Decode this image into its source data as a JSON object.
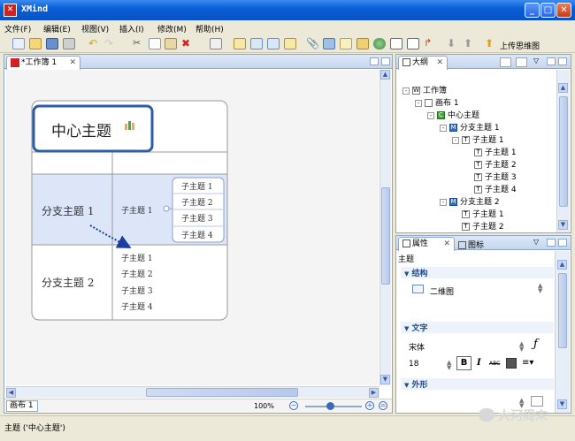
{
  "window": {
    "title": "XMind",
    "app_icon": "xmind-icon"
  },
  "menu": [
    {
      "label": "文件(F)"
    },
    {
      "label": "编辑(E)"
    },
    {
      "label": "视图(V)"
    },
    {
      "label": "插入(I)"
    },
    {
      "label": "修改(M)"
    },
    {
      "label": "帮助(H)"
    }
  ],
  "toolbar": {
    "upload_label": "上传思维图"
  },
  "editor": {
    "tab_label": "*工作簿 1",
    "sheet_tab": "画布 1",
    "zoom": "100%"
  },
  "map": {
    "central": "中心主题",
    "branch1": "分支主题 1",
    "branch2": "分支主题 2",
    "b1_sub": "子主题 1",
    "b1_subsub": [
      "子主题 1",
      "子主题 2",
      "子主题 3",
      "子主题 4"
    ],
    "b2_sub": [
      "子主题 1",
      "子主题 2",
      "子主题 3",
      "子主题 4"
    ]
  },
  "outline": {
    "tab_label": "大纲",
    "rows": [
      {
        "label": "工作簿",
        "icon": "W",
        "expander": "-"
      },
      {
        "label": "画布 1",
        "icon": "",
        "expander": "-"
      },
      {
        "label": "中心主题",
        "icon": "C",
        "expander": "-"
      },
      {
        "label": "分支主题 1",
        "icon": "M",
        "expander": "-"
      },
      {
        "label": "子主题 1",
        "icon": "T",
        "expander": "-"
      },
      {
        "label": "子主题 1",
        "icon": "T",
        "expander": ""
      },
      {
        "label": "子主题 2",
        "icon": "T",
        "expander": ""
      },
      {
        "label": "子主题 3",
        "icon": "T",
        "expander": ""
      },
      {
        "label": "子主题 4",
        "icon": "T",
        "expander": ""
      },
      {
        "label": "分支主题 2",
        "icon": "M",
        "expander": "-"
      },
      {
        "label": "子主题 1",
        "icon": "T",
        "expander": ""
      },
      {
        "label": "子主题 2",
        "icon": "T",
        "expander": ""
      }
    ]
  },
  "properties": {
    "tab_label": "属性",
    "icons_tab_label": "图标",
    "heading": "主题",
    "structure_section": "结构",
    "structure_value": "二维图",
    "text_section": "文字",
    "font_name": "宋体",
    "font_size": "18",
    "bold": "B",
    "italic": "I",
    "strike": "ABC",
    "shape_section": "外形"
  },
  "status": {
    "text": "主题 ('中心主题')"
  },
  "watermark": "大河周末",
  "colors": {
    "accent": "#2f5ea8",
    "branch_fill": "#dde6f8",
    "arrow": "#1a3ea0"
  }
}
